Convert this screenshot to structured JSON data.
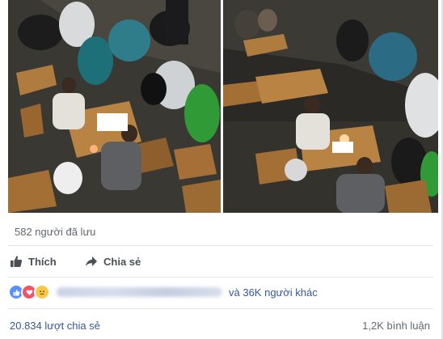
{
  "post": {
    "saved_text": "582 người đã lưu",
    "actions": {
      "like_label": "Thích",
      "share_label": "Chia sẻ"
    },
    "reactions": {
      "icons": [
        "like-icon",
        "love-icon",
        "sad-icon"
      ],
      "others_text": "và 36K người khác"
    },
    "stats": {
      "shares_text": "20.834 lượt chia sẻ",
      "comments_text": "1,2K bình luận"
    }
  },
  "colors": {
    "link": "#365899",
    "muted": "#616770",
    "like_blue": "#5890ff",
    "love_red": "#f25268",
    "sad_yellow": "#f7c948"
  }
}
